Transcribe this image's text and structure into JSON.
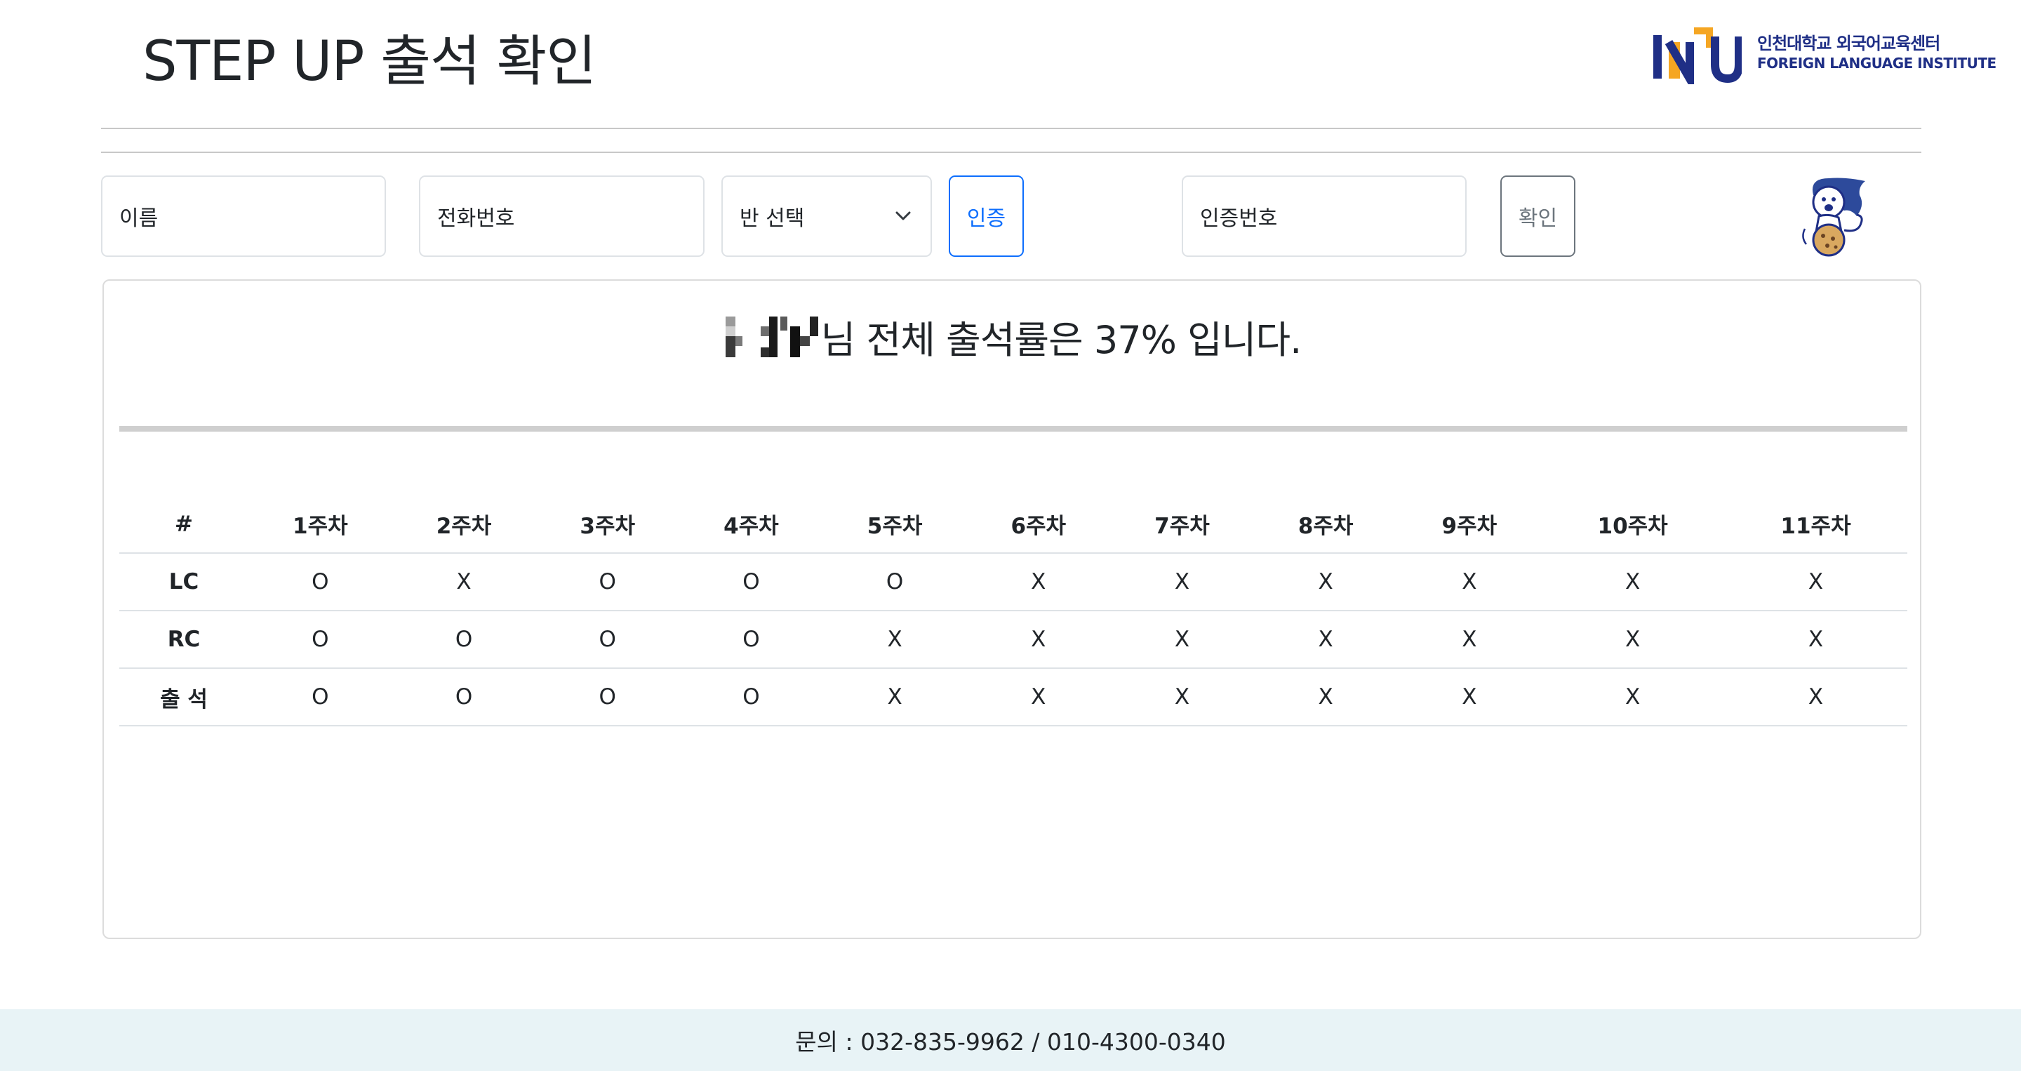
{
  "header": {
    "title": "STEP UP 출석 확인",
    "logo_ko": "인천대학교 외국어교육센터",
    "logo_en": "FOREIGN LANGUAGE INSTITUTE"
  },
  "form": {
    "name_placeholder": "이름",
    "phone_placeholder": "전화번호",
    "class_select": "반 선택",
    "verify_button": "인증",
    "code_placeholder": "인증번호",
    "confirm_button": "확인",
    "mascot_icon": "lion-mascot-icon"
  },
  "summary": {
    "text": "님 전체 출석률은 37% 입니다.",
    "rate": 37
  },
  "table": {
    "headers": [
      "#",
      "1주차",
      "2주차",
      "3주차",
      "4주차",
      "5주차",
      "6주차",
      "7주차",
      "8주차",
      "9주차",
      "10주차",
      "11주차"
    ],
    "rows": [
      {
        "label": "LC",
        "cells": [
          "O",
          "X",
          "O",
          "O",
          "O",
          "X",
          "X",
          "X",
          "X",
          "X",
          "X"
        ]
      },
      {
        "label": "RC",
        "cells": [
          "O",
          "O",
          "O",
          "O",
          "X",
          "X",
          "X",
          "X",
          "X",
          "X",
          "X"
        ]
      },
      {
        "label": "출 석",
        "cells": [
          "O",
          "O",
          "O",
          "O",
          "X",
          "X",
          "X",
          "X",
          "X",
          "X",
          "X"
        ]
      }
    ]
  },
  "footer": {
    "contact": "문의 : 032-835-9962 / 010-4300-0340"
  },
  "colors": {
    "primary": "#0d6efd",
    "secondary": "#6c757d",
    "logo_blue": "#1f2f86",
    "logo_yellow": "#f5a623",
    "footer_bg": "#e8f3f6"
  }
}
